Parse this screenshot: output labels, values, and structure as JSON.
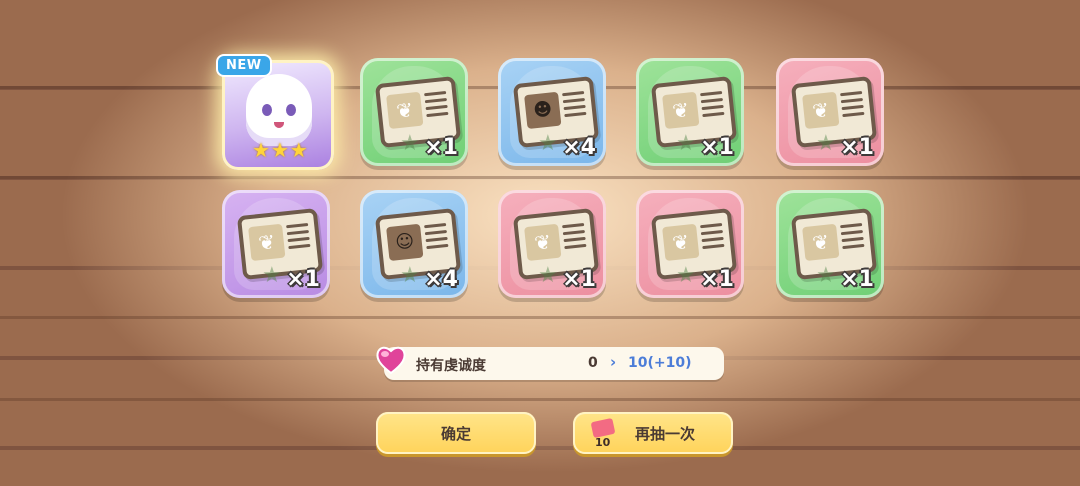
{
  "new_card": {
    "badge": "NEW",
    "rarity_stars": 3
  },
  "cards": [
    {
      "color": "green",
      "item": "ticket",
      "count": "×1"
    },
    {
      "color": "blue",
      "item": "ticket-portrait",
      "count": "×4"
    },
    {
      "color": "green",
      "item": "ticket",
      "count": "×1"
    },
    {
      "color": "pink",
      "item": "ticket",
      "count": "×1"
    },
    {
      "color": "purple",
      "item": "ticket",
      "count": "×1"
    },
    {
      "color": "blue",
      "item": "ticket-portrait",
      "count": "×4"
    },
    {
      "color": "pink",
      "item": "ticket",
      "count": "×1"
    },
    {
      "color": "pink",
      "item": "ticket",
      "count": "×1"
    },
    {
      "color": "green",
      "item": "ticket",
      "count": "×1"
    }
  ],
  "faith": {
    "label": "持有虔诚度",
    "old_value": "0",
    "arrow": "›",
    "new_value": "10(+10)"
  },
  "buttons": {
    "confirm": "确定",
    "draw_again": "再抽一次",
    "draw_cost": "10"
  },
  "colors": {
    "button_yellow": "#ffd35a",
    "faith_value_blue": "#4c7dd8",
    "card_green": "#6fcf75",
    "card_blue": "#7ab6ea",
    "card_pink": "#ec8e9f",
    "card_purple": "#b88be3"
  }
}
